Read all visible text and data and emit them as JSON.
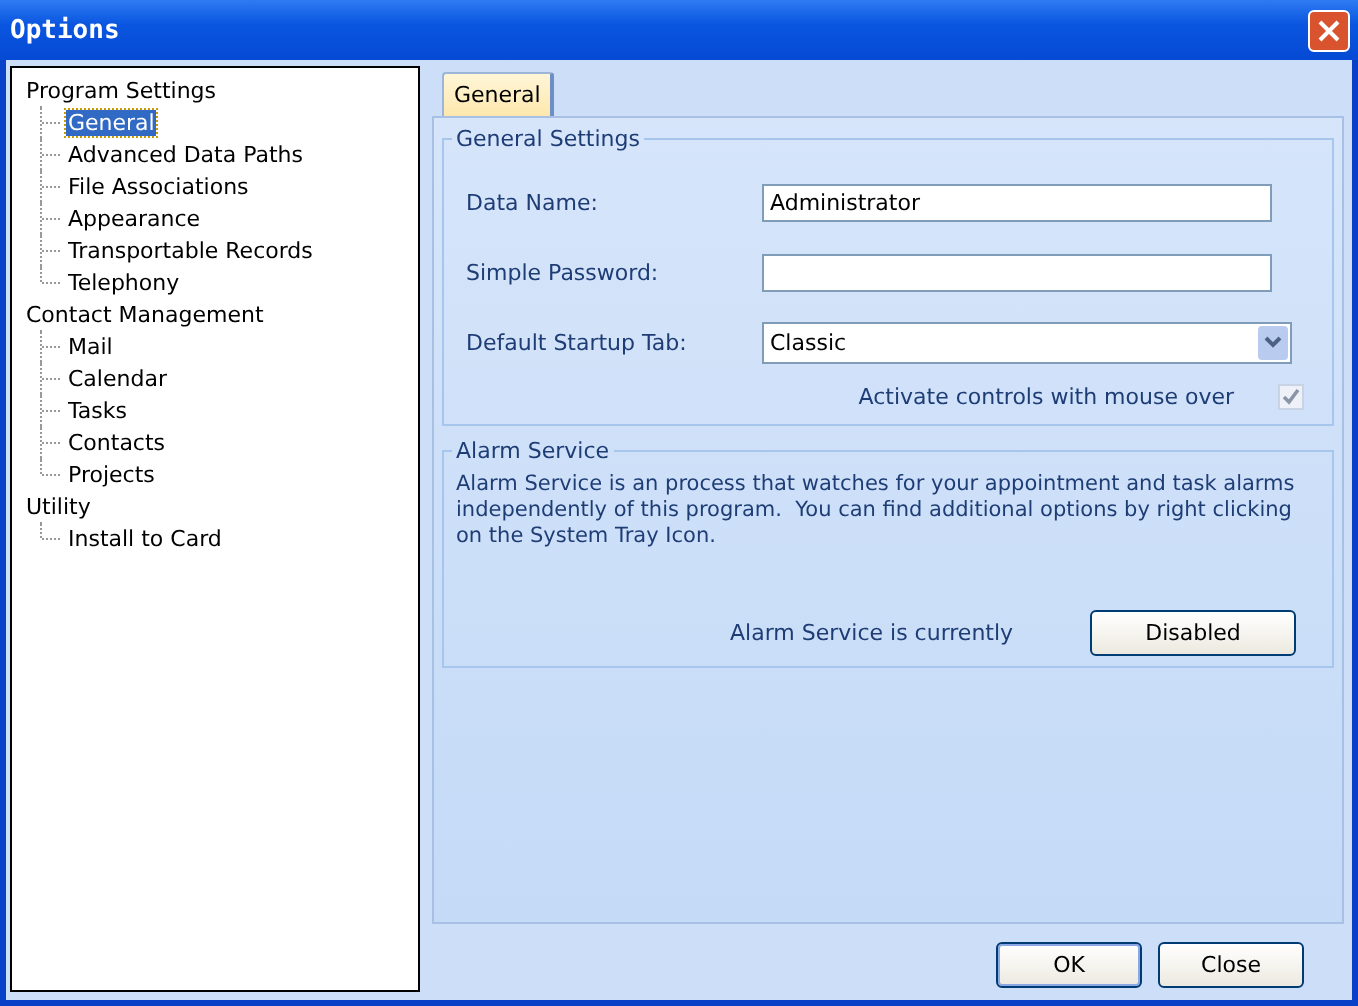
{
  "window": {
    "title": "Options"
  },
  "tree": [
    {
      "label": "Program Settings",
      "selected": false,
      "children": [
        {
          "label": "General",
          "selected": true
        },
        {
          "label": "Advanced Data Paths",
          "selected": false
        },
        {
          "label": "File Associations",
          "selected": false
        },
        {
          "label": "Appearance",
          "selected": false
        },
        {
          "label": "Transportable Records",
          "selected": false
        },
        {
          "label": "Telephony",
          "selected": false
        }
      ]
    },
    {
      "label": "Contact Management",
      "selected": false,
      "children": [
        {
          "label": "Mail",
          "selected": false
        },
        {
          "label": "Calendar",
          "selected": false
        },
        {
          "label": "Tasks",
          "selected": false
        },
        {
          "label": "Contacts",
          "selected": false
        },
        {
          "label": "Projects",
          "selected": false
        }
      ]
    },
    {
      "label": "Utility",
      "selected": false,
      "children": [
        {
          "label": "Install to Card",
          "selected": false
        }
      ]
    }
  ],
  "tabs": [
    {
      "label": "General",
      "selected": true
    }
  ],
  "general_settings": {
    "title": "General Settings",
    "fields": [
      {
        "kind": "text",
        "label": "Data Name:",
        "value": "Administrator"
      },
      {
        "kind": "text",
        "label": "Simple Password:"
      },
      {
        "kind": "dropdown",
        "label": "Default Startup Tab:",
        "value": "Classic"
      }
    ],
    "checkbox": {
      "label": "Activate controls with mouse over",
      "checked": true
    }
  },
  "alarm_service": {
    "title": "Alarm Service",
    "description": "Alarm Service is an process that watches for your appointment and task alarms independently of this program.  You can find additional options by right clicking on the System Tray Icon.",
    "status_label": "Alarm Service is currently",
    "status_button": "Disabled"
  },
  "buttons": [
    "OK",
    "Close"
  ]
}
